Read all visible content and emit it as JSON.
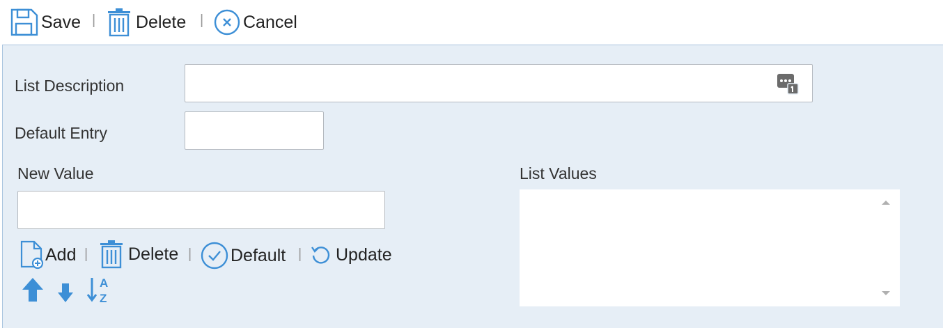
{
  "toolbar": {
    "save_label": "Save",
    "delete_label": "Delete",
    "cancel_label": "Cancel",
    "separator": "|"
  },
  "form": {
    "list_description_label": "List Description",
    "list_description_value": "",
    "default_entry_label": "Default Entry",
    "default_entry_value": "",
    "new_value_label": "New Value",
    "new_value_value": "",
    "list_values_label": "List Values",
    "list_values_items": []
  },
  "actions": {
    "add_label": "Add",
    "delete_label": "Delete",
    "default_label": "Default",
    "update_label": "Update",
    "separator": "|"
  },
  "icons": {
    "accent": "#3d8fd6",
    "gray": "#666666"
  }
}
